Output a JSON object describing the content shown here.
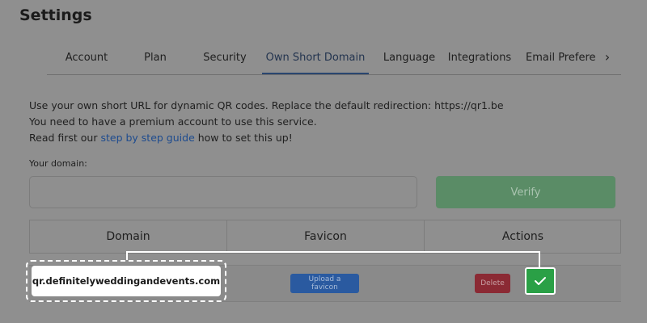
{
  "page": {
    "title": "Settings"
  },
  "tabs": [
    {
      "label": "Account"
    },
    {
      "label": "Plan"
    },
    {
      "label": "Security"
    },
    {
      "label": "Own Short Domain",
      "active": true
    },
    {
      "label": "Language"
    },
    {
      "label": "Integrations"
    },
    {
      "label": "Email Preferences"
    }
  ],
  "tabs_more_icon": "chevron-right-icon",
  "intro": {
    "line1": "Use your own short URL for dynamic QR codes. Replace the default redirection: https://qr1.be",
    "line2": "You need to have a premium account to use this service.",
    "line3_prefix": "Read first our ",
    "line3_link": "step by step guide",
    "line3_suffix": " how to set this up!"
  },
  "domain_form": {
    "label": "Your domain:",
    "value": "",
    "placeholder": "",
    "verify_label": "Verify"
  },
  "table": {
    "headers": [
      "Domain",
      "Favicon",
      "Actions"
    ],
    "rows": [
      {
        "domain": "qr.definitelyweddingandevents.com",
        "upload_label": "Upload a favicon",
        "delete_label": "Delete",
        "confirm_icon": "check-icon"
      }
    ]
  },
  "colors": {
    "verify": "#5a8c66",
    "upload": "#2a5aa0",
    "delete": "#8b2a34",
    "confirm": "#2aa046",
    "active_tab": "#2a4670",
    "link": "#1d4b8f"
  }
}
